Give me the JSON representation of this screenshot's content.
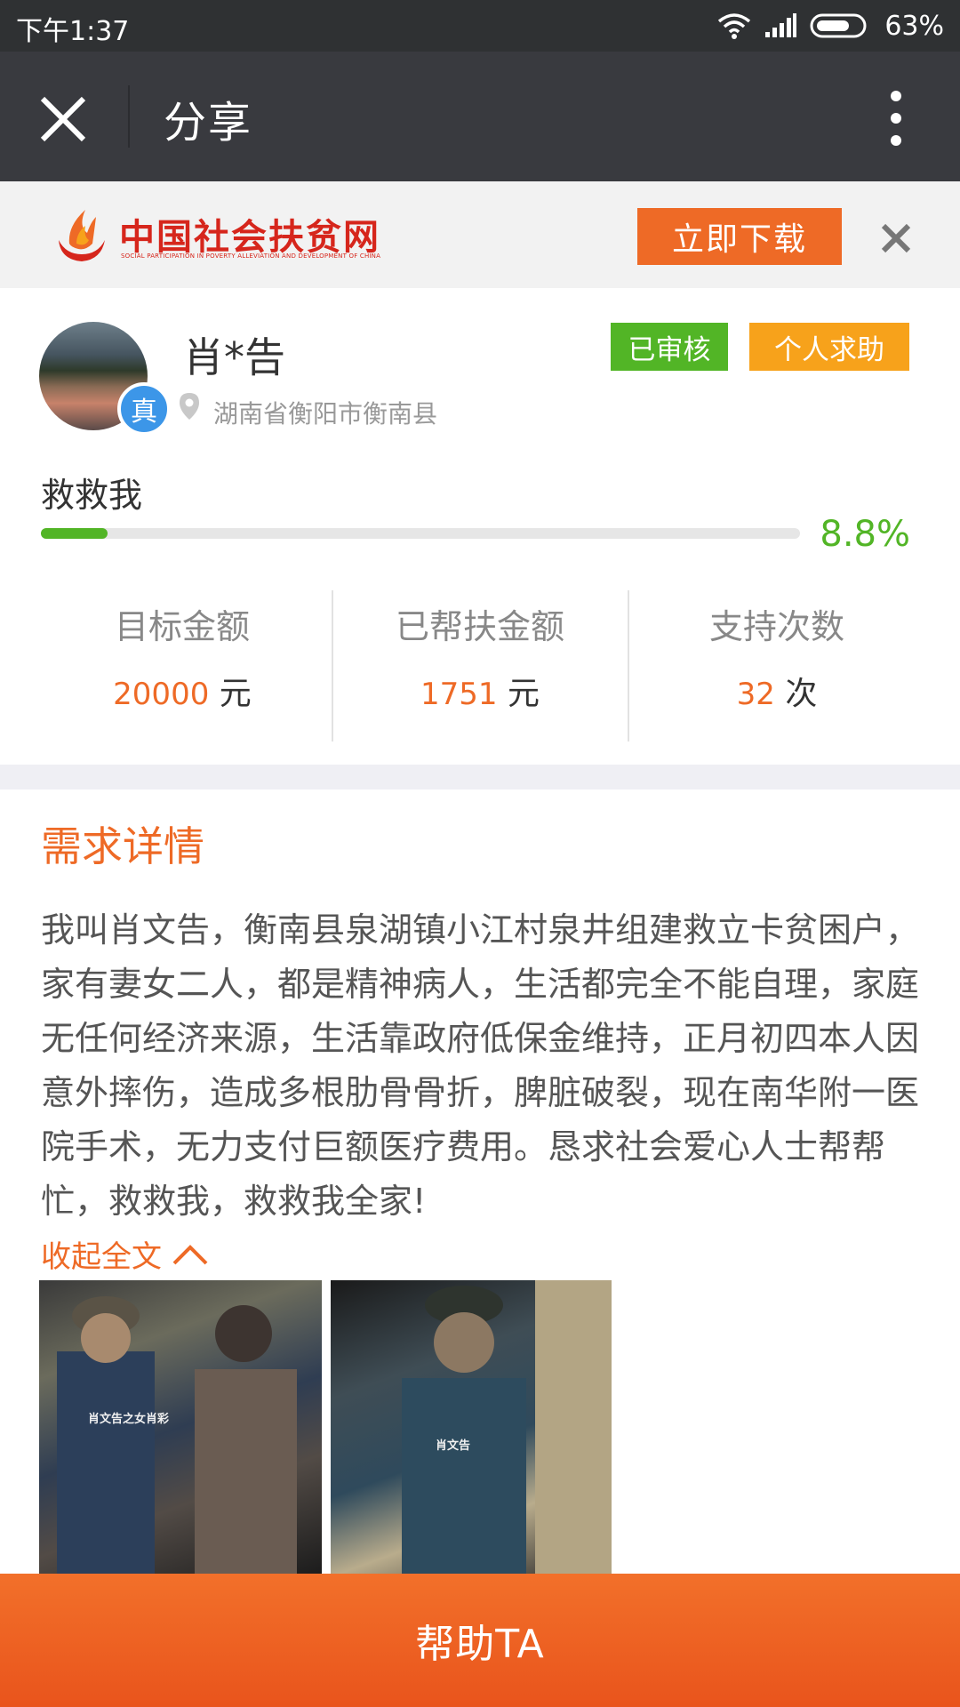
{
  "status_bar": {
    "time": "下午1:37",
    "battery": "63%"
  },
  "title_bar": {
    "title": "分享"
  },
  "banner": {
    "logo_cn": "中国社会扶贫网",
    "logo_en": "SOCIAL PARTICIPATION IN POVERTY ALLEVIATION AND DEVELOPMENT OF CHINA",
    "download_label": "立即下载"
  },
  "profile": {
    "name": "肖*告",
    "verified_badge": "真",
    "location": "湖南省衡阳市衡南县",
    "tags": [
      "已审核",
      "个人求助"
    ]
  },
  "project": {
    "title": "救救我",
    "progress_percent": 8.8,
    "progress_label": "8.8%"
  },
  "stats": [
    {
      "label": "目标金额",
      "value": "20000",
      "unit": "元"
    },
    {
      "label": "已帮扶金额",
      "value": "1751",
      "unit": "元"
    },
    {
      "label": "支持次数",
      "value": "32",
      "unit": "次"
    }
  ],
  "details": {
    "heading": "需求详情",
    "body": "我叫肖文告，衡南县泉湖镇小江村泉井组建救立卡贫困户，家有妻女二人，都是精神病人，生活都完全不能自理，家庭无任何经济来源，生活靠政府低保金维持，正月初四本人因意外摔伤，造成多根肋骨骨折，脾脏破裂，现在南华附一医院手术，无力支付巨额医疗费用。恳求社会爱心人士帮帮忙，救救我，救救我全家!",
    "collapse_label": "收起全文"
  },
  "photos": [
    {
      "caption": "肖文告之女肖彩"
    },
    {
      "caption": "肖文告"
    }
  ],
  "action": {
    "help_label": "帮助TA"
  },
  "colors": {
    "accent": "#ee6a26",
    "green": "#52b526",
    "amber": "#f7a21b",
    "titlebar": "#393a3f"
  }
}
